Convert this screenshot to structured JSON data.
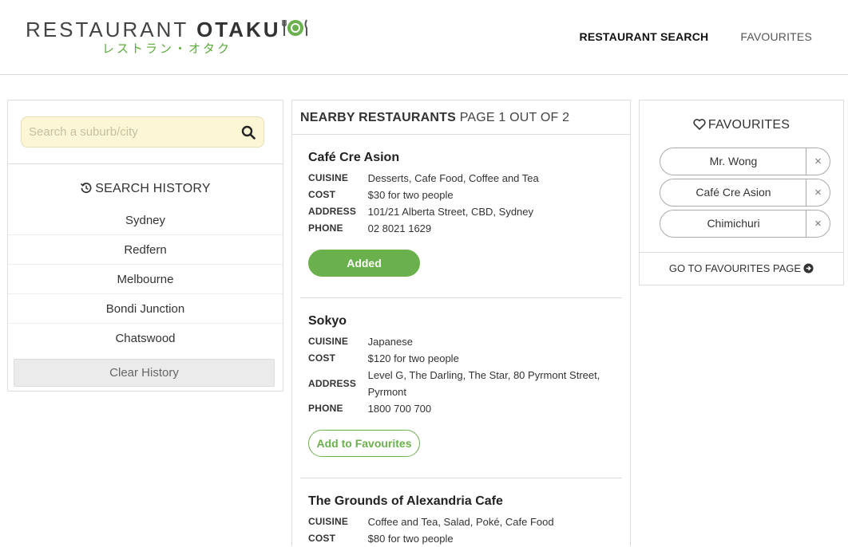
{
  "brand": {
    "name_light": "RESTAURANT",
    "name_bold": "OTAKU",
    "subtitle": "レストラン・オタク",
    "accent": "#6ab04c"
  },
  "nav": {
    "search_label": "RESTAURANT SEARCH",
    "favourites_label": "FAVOURITES"
  },
  "search": {
    "placeholder": "Search a suburb/city",
    "icon": "search-icon"
  },
  "history": {
    "title": "SEARCH HISTORY",
    "icon": "history-icon",
    "items": [
      "Sydney",
      "Redfern",
      "Melbourne",
      "Bondi Junction",
      "Chatswood"
    ],
    "clear_label": "Clear History"
  },
  "results": {
    "title": "NEARBY RESTAURANTS",
    "page_text": "PAGE 1 OUT OF 2",
    "labels": {
      "cuisine": "CUISINE",
      "cost": "COST",
      "address": "ADDRESS",
      "phone": "PHONE"
    },
    "restaurants": [
      {
        "name": "Café Cre Asion",
        "cuisine": "Desserts, Cafe Food, Coffee and Tea",
        "cost": "$30 for two people",
        "address": "101/21 Alberta Street, CBD, Sydney",
        "phone": "02 8021 1629",
        "button": "Added"
      },
      {
        "name": "Sokyo",
        "cuisine": "Japanese",
        "cost": "$120 for two people",
        "address": "Level G, The Darling, The Star, 80 Pyrmont Street, Pyrmont",
        "phone": "1800 700 700",
        "button": "Add to Favourites"
      },
      {
        "name": "The Grounds of Alexandria Cafe",
        "cuisine": "Coffee and Tea, Salad, Poké, Cafe Food",
        "cost": "$80 for two people"
      }
    ]
  },
  "favourites": {
    "title": "FAVOURITES",
    "icon": "heart-icon",
    "items": [
      "Mr. Wong",
      "Café Cre Asion",
      "Chimichuri"
    ],
    "remove_glyph": "×",
    "footer_label": "GO TO FAVOURITES PAGE"
  }
}
